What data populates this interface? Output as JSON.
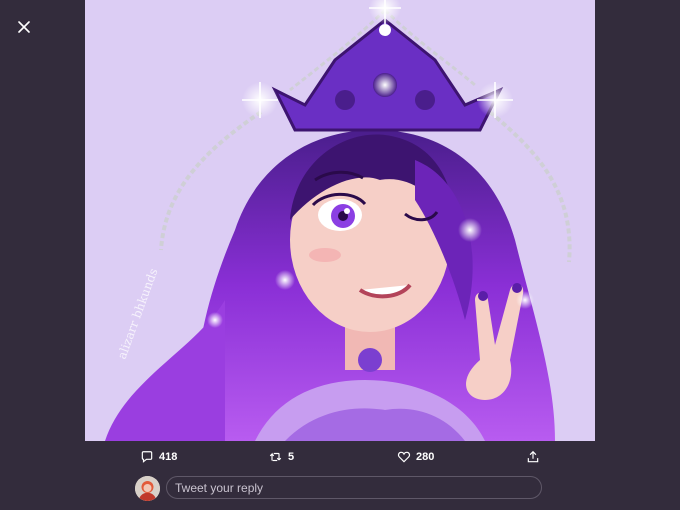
{
  "viewer": {
    "close_icon": "close-icon",
    "image": {
      "alt": "Illustration of a woman with long purple hair wearing a purple crown, winking and making a peace sign",
      "background_color": "#dccdf4",
      "watermark": "alizarr bhkunds"
    }
  },
  "actions": {
    "reply": {
      "icon": "reply-icon",
      "count": "418"
    },
    "retweet": {
      "icon": "retweet-icon",
      "count": "5"
    },
    "like": {
      "icon": "heart-icon",
      "count": "280"
    },
    "share": {
      "icon": "share-icon"
    }
  },
  "reply_box": {
    "placeholder": "Tweet your reply",
    "value": ""
  },
  "colors": {
    "backdrop": "#332c3c",
    "text": "#ffffff",
    "input_border": "#5f5868"
  }
}
